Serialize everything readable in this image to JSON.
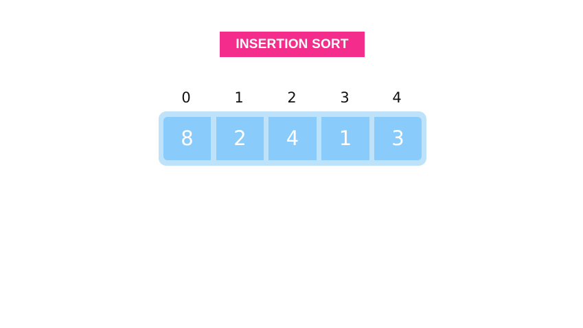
{
  "title": "INSERTION SORT",
  "array": {
    "indices": [
      "0",
      "1",
      "2",
      "3",
      "4"
    ],
    "values": [
      "8",
      "2",
      "4",
      "1",
      "3"
    ]
  },
  "colors": {
    "title_background": "#f42d8d",
    "title_text": "#ffffff",
    "frame": "#bfe2fb",
    "cell": "#89cbfb",
    "cell_text": "#ffffff",
    "index_text": "#111111"
  }
}
